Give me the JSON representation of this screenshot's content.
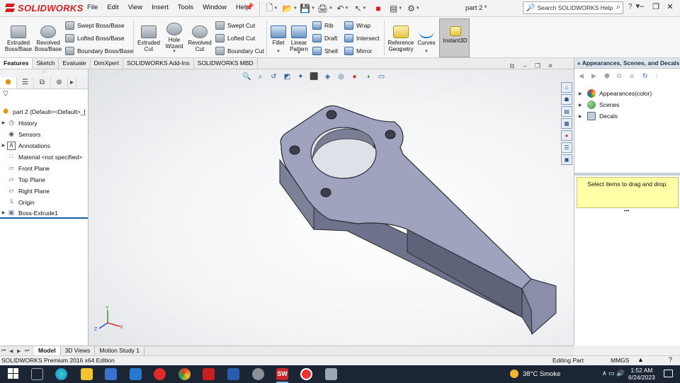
{
  "app": {
    "brand": "SOLIDWORKS",
    "document_title": "part 2 *",
    "menu": [
      "File",
      "Edit",
      "View",
      "Insert",
      "Tools",
      "Window",
      "Help"
    ],
    "search_placeholder": "Search SOLIDWORKS Help"
  },
  "ribbon": {
    "extruded_boss": "Extruded Boss/Base",
    "revolved_boss": "Revolved Boss/Base",
    "swept_boss": "Swept Boss/Base",
    "lofted_boss": "Lofted Boss/Base",
    "boundary_boss": "Boundary Boss/Base",
    "extruded_cut": "Extruded Cut",
    "hole_wizard": "Hole Wizard",
    "revolved_cut": "Revolved Cut",
    "swept_cut": "Swept Cut",
    "lofted_cut": "Lofted Cut",
    "boundary_cut": "Boundary Cut",
    "fillet": "Fillet",
    "linear_pattern": "Linear Pattern",
    "rib": "Rib",
    "draft": "Draft",
    "shell": "Shell",
    "wrap": "Wrap",
    "intersect": "Intersect",
    "mirror": "Mirror",
    "reference_geometry": "Reference Geometry",
    "curves": "Curves",
    "instant3d": "Instant3D"
  },
  "command_tabs": [
    "Features",
    "Sketch",
    "Evaluate",
    "DimXpert",
    "SOLIDWORKS Add-Ins",
    "SOLIDWORKS MBD"
  ],
  "feature_tree": {
    "root": "part 2  (Default<<Default>_[",
    "items": [
      {
        "label": "History",
        "icon": "history-icon",
        "expandable": true
      },
      {
        "label": "Sensors",
        "icon": "sensors-icon",
        "expandable": false
      },
      {
        "label": "Annotations",
        "icon": "annotations-icon",
        "expandable": true
      },
      {
        "label": "Material <not specified>",
        "icon": "material-icon",
        "expandable": false
      },
      {
        "label": "Front Plane",
        "icon": "plane-icon",
        "expandable": false
      },
      {
        "label": "Top Plane",
        "icon": "plane-icon",
        "expandable": false
      },
      {
        "label": "Right Plane",
        "icon": "plane-icon",
        "expandable": false
      },
      {
        "label": "Origin",
        "icon": "origin-icon",
        "expandable": false
      },
      {
        "label": "Boss-Extrude1",
        "icon": "extrude-icon",
        "expandable": true
      }
    ]
  },
  "task_pane": {
    "title": "Appearances, Scenes, and Decals",
    "items": [
      {
        "label": "Appearances(color)",
        "color": "#d8453a"
      },
      {
        "label": "Scenes",
        "color": "#3f8f3f"
      },
      {
        "label": "Decals",
        "color": "#5a6a7a"
      }
    ],
    "drop_hint": "Select items to drag and drop."
  },
  "bottom_tabs": [
    "Model",
    "3D Views",
    "Motion Study 1"
  ],
  "status_bar": {
    "edition": "SOLIDWORKS Premium 2016 x64 Edition",
    "mode": "Editing Part",
    "units": "MMGS",
    "units_caret": "▲",
    "help": "?"
  },
  "taskbar": {
    "weather": "38°C  Smoke",
    "time": "1:52 AM",
    "date": "6/24/2023",
    "sw_label": "SW"
  },
  "colors": {
    "brand_red": "#d11f26",
    "part_face": "#9fa3bd",
    "part_side": "#6e728a",
    "accent_blue": "#1f5fa8"
  }
}
